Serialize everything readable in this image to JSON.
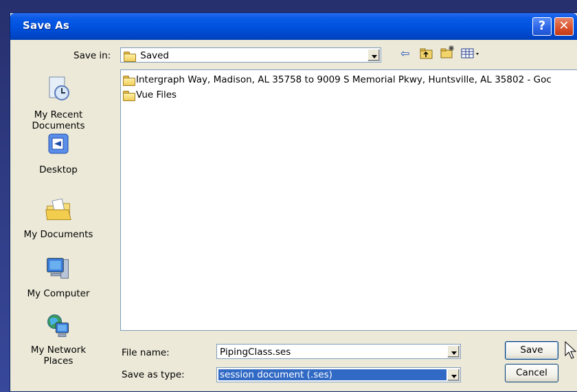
{
  "window": {
    "title": "Save As"
  },
  "titlebar_buttons": {
    "help": "?",
    "close": "✕"
  },
  "save_in": {
    "label": "Save in:",
    "value": "Saved"
  },
  "toolbar": {
    "back_icon": "back-arrow-icon",
    "up_icon": "up-folder-icon",
    "new_folder_icon": "new-folder-icon",
    "views_icon": "views-menu-icon"
  },
  "places": [
    {
      "label": "My Recent Documents",
      "icon": "recent-documents-icon"
    },
    {
      "label": "Desktop",
      "icon": "desktop-icon"
    },
    {
      "label": "My Documents",
      "icon": "my-documents-icon"
    },
    {
      "label": "My Computer",
      "icon": "my-computer-icon"
    },
    {
      "label": "My Network Places",
      "icon": "network-places-icon"
    }
  ],
  "places_text": {
    "recent_line1": "My Recent",
    "recent_line2": "Documents",
    "desktop": "Desktop",
    "documents": "My Documents",
    "computer": "My Computer",
    "network_line1": "My Network",
    "network_line2": "Places"
  },
  "files": [
    {
      "name": "Intergraph Way, Madison, AL 35758 to 9009 S Memorial Pkwy, Huntsville, AL 35802 - Goc",
      "type": "folder"
    },
    {
      "name": "Vue Files",
      "type": "folder"
    }
  ],
  "file_name": {
    "label": "File name:",
    "value": "PipingClass.ses"
  },
  "save_as_type": {
    "label": "Save as type:",
    "value": "session document (.ses)"
  },
  "buttons": {
    "save": "Save",
    "cancel": "Cancel"
  },
  "colors": {
    "titlebar": "#0052df",
    "selection": "#316ac5",
    "dialog_bg": "#ece9d8"
  }
}
